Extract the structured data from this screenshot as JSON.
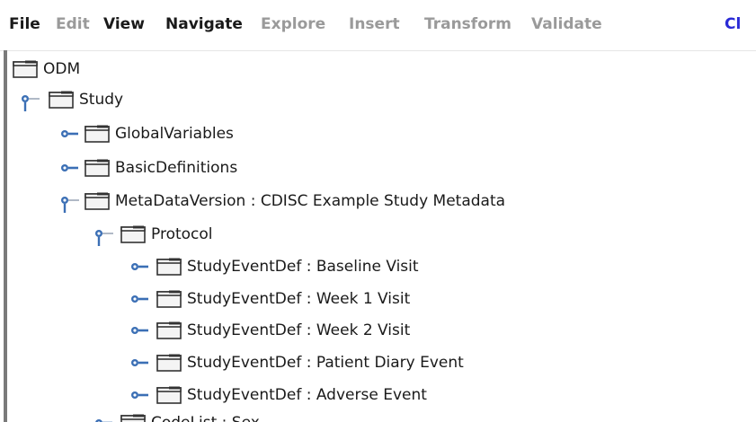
{
  "menubar": {
    "items": [
      {
        "label": "File",
        "enabled": true
      },
      {
        "label": "Edit",
        "enabled": false
      },
      {
        "label": "View",
        "enabled": true
      },
      {
        "label": "Navigate",
        "enabled": true
      },
      {
        "label": "Explore",
        "enabled": false
      },
      {
        "label": "Insert",
        "enabled": false
      },
      {
        "label": "Transform",
        "enabled": false
      },
      {
        "label": "Validate",
        "enabled": false
      },
      {
        "label": "Cl",
        "enabled": true
      }
    ]
  },
  "tree": {
    "nodes": [
      {
        "label": "ODM",
        "toggle": "none"
      },
      {
        "label": "Study",
        "toggle": "expanded"
      },
      {
        "label": "GlobalVariables",
        "toggle": "collapsed"
      },
      {
        "label": "BasicDefinitions",
        "toggle": "collapsed"
      },
      {
        "label": "MetaDataVersion : CDISC Example Study Metadata",
        "toggle": "expanded"
      },
      {
        "label": "Protocol",
        "toggle": "expanded"
      },
      {
        "label": "StudyEventDef : Baseline Visit",
        "toggle": "collapsed"
      },
      {
        "label": "StudyEventDef : Week 1 Visit",
        "toggle": "collapsed"
      },
      {
        "label": "StudyEventDef : Week 2 Visit",
        "toggle": "collapsed"
      },
      {
        "label": "StudyEventDef : Patient Diary Event",
        "toggle": "collapsed"
      },
      {
        "label": "StudyEventDef : Adverse Event",
        "toggle": "collapsed"
      },
      {
        "label": "CodeList : Sex",
        "toggle": "collapsed"
      }
    ]
  },
  "colors": {
    "menu_enabled": "#1a1a1a",
    "menu_disabled": "#9a9a9a",
    "menu_accent": "#2a2ad6",
    "toggle_blue": "#3b6fb5",
    "folder_outline": "#333333"
  },
  "icons": {
    "folder": "folder-icon",
    "expanded": "expanded-toggle-icon",
    "collapsed": "collapsed-toggle-icon"
  }
}
